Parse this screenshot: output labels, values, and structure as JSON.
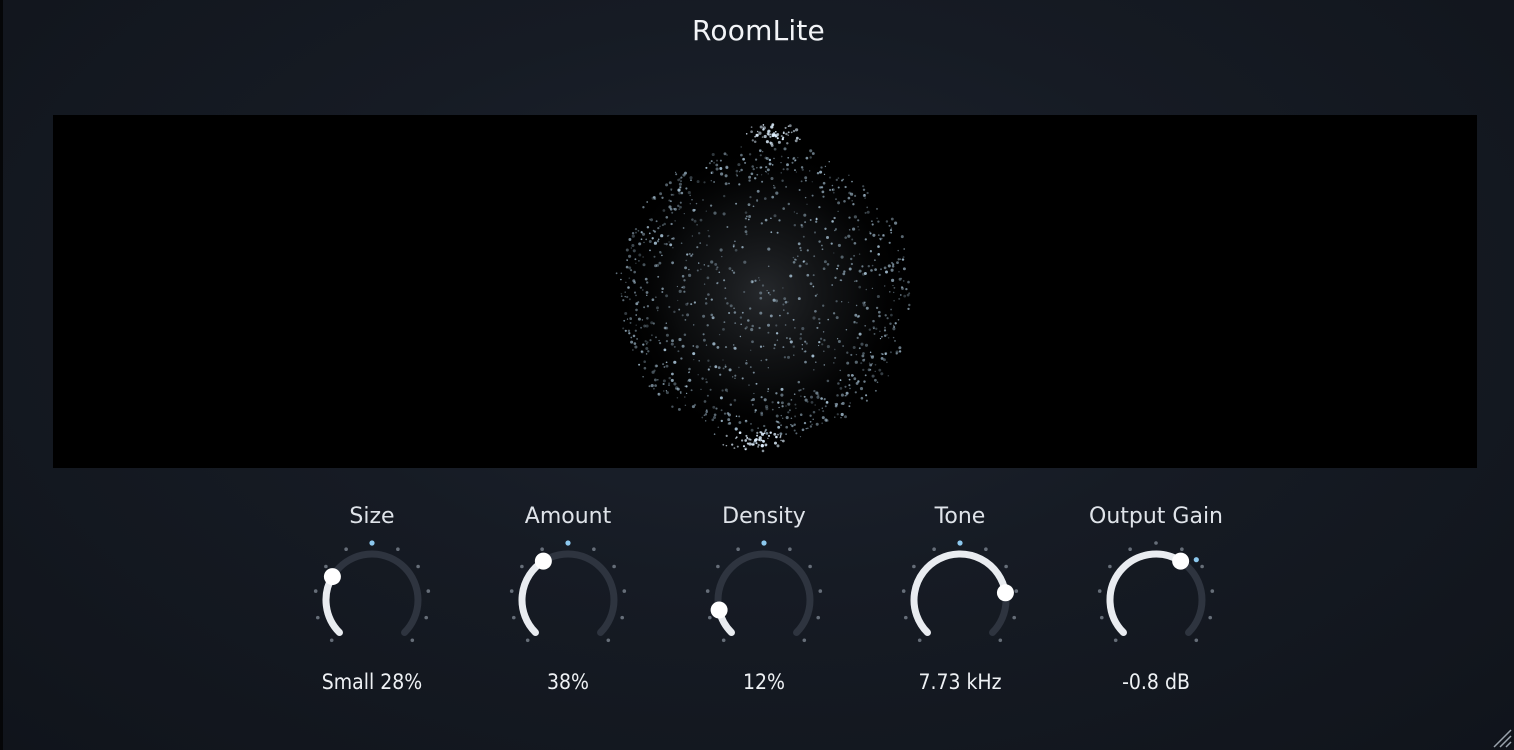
{
  "app": {
    "title": "RoomLite"
  },
  "colors": {
    "accent": "#8cc8ee",
    "track": "#2e343f",
    "arc": "#e9ecf0",
    "particle": "#b9d7ec"
  },
  "knobs": [
    {
      "id": "size",
      "label": "Size",
      "value_text": "Small 28%",
      "level": 0.28,
      "name": "size-knob"
    },
    {
      "id": "amount",
      "label": "Amount",
      "value_text": "38%",
      "level": 0.38,
      "name": "amount-knob"
    },
    {
      "id": "density",
      "label": "Density",
      "value_text": "12%",
      "level": 0.12,
      "name": "density-knob"
    },
    {
      "id": "tone",
      "label": "Tone",
      "value_text": "7.73 kHz",
      "level": 0.8,
      "name": "tone-knob"
    },
    {
      "id": "output_gain",
      "label": "Output Gain",
      "value_text": "-0.8 dB",
      "level": 0.62,
      "name": "output-gain-knob"
    }
  ],
  "icons": {
    "resize": "resize-grip-icon"
  }
}
